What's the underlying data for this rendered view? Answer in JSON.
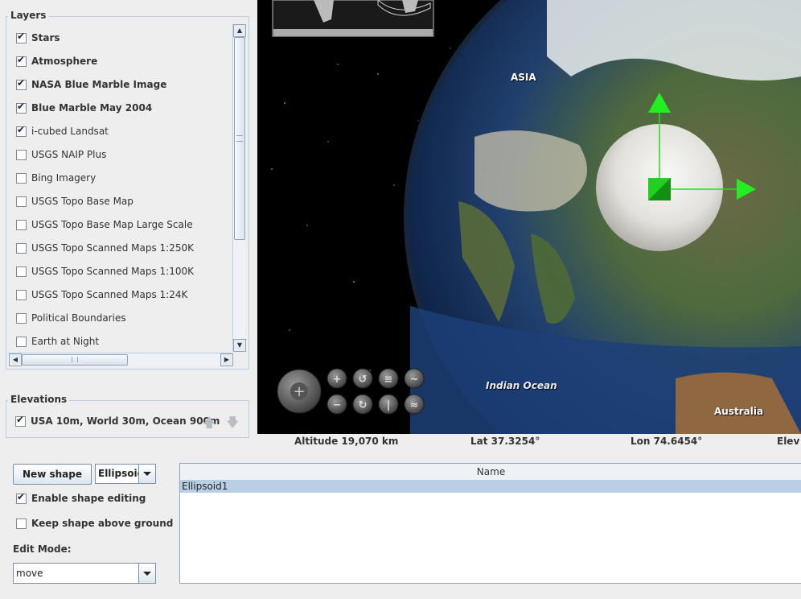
{
  "layers_panel": {
    "title": "Layers",
    "items": [
      {
        "label": "Stars",
        "checked": true,
        "bold": true
      },
      {
        "label": "Atmosphere",
        "checked": true,
        "bold": true
      },
      {
        "label": "NASA Blue Marble Image",
        "checked": true,
        "bold": true
      },
      {
        "label": "Blue Marble May 2004",
        "checked": true,
        "bold": true
      },
      {
        "label": "i-cubed Landsat",
        "checked": true,
        "bold": false
      },
      {
        "label": "USGS NAIP Plus",
        "checked": false,
        "bold": false
      },
      {
        "label": "Bing Imagery",
        "checked": false,
        "bold": false
      },
      {
        "label": "USGS Topo Base Map",
        "checked": false,
        "bold": false
      },
      {
        "label": "USGS Topo Base Map Large Scale",
        "checked": false,
        "bold": false
      },
      {
        "label": "USGS Topo Scanned Maps 1:250K",
        "checked": false,
        "bold": false
      },
      {
        "label": "USGS Topo Scanned Maps 1:100K",
        "checked": false,
        "bold": false
      },
      {
        "label": "USGS Topo Scanned Maps 1:24K",
        "checked": false,
        "bold": false
      },
      {
        "label": "Political Boundaries",
        "checked": false,
        "bold": false
      },
      {
        "label": "Earth at Night",
        "checked": false,
        "bold": false
      }
    ]
  },
  "elevations_panel": {
    "title": "Elevations",
    "item": {
      "label": "USA 10m, World 30m, Ocean 900m",
      "checked": true
    }
  },
  "map_labels": {
    "asia": "ASIA",
    "indian_ocean": "Indian Ocean",
    "australia": "Australia"
  },
  "status_bar": {
    "altitude": "Altitude  19,070 km",
    "lat": "Lat 37.3254°",
    "lon": "Lon 74.6454°",
    "elev": "Elev"
  },
  "shape_controls": {
    "new_shape_label": "New shape",
    "shape_type": "Ellipsoid",
    "enable_editing_label": "Enable shape editing",
    "enable_editing_checked": true,
    "keep_above_label": "Keep shape above ground",
    "keep_above_checked": false,
    "edit_mode_label": "Edit Mode:",
    "edit_mode_value": "move"
  },
  "shapes_table": {
    "column": "Name",
    "rows": [
      "Ellipsoid1"
    ]
  },
  "colors": {
    "border_blue": "#b8cfe5",
    "selection": "#b8cfe5",
    "gizmo_green": "#22dd22"
  }
}
